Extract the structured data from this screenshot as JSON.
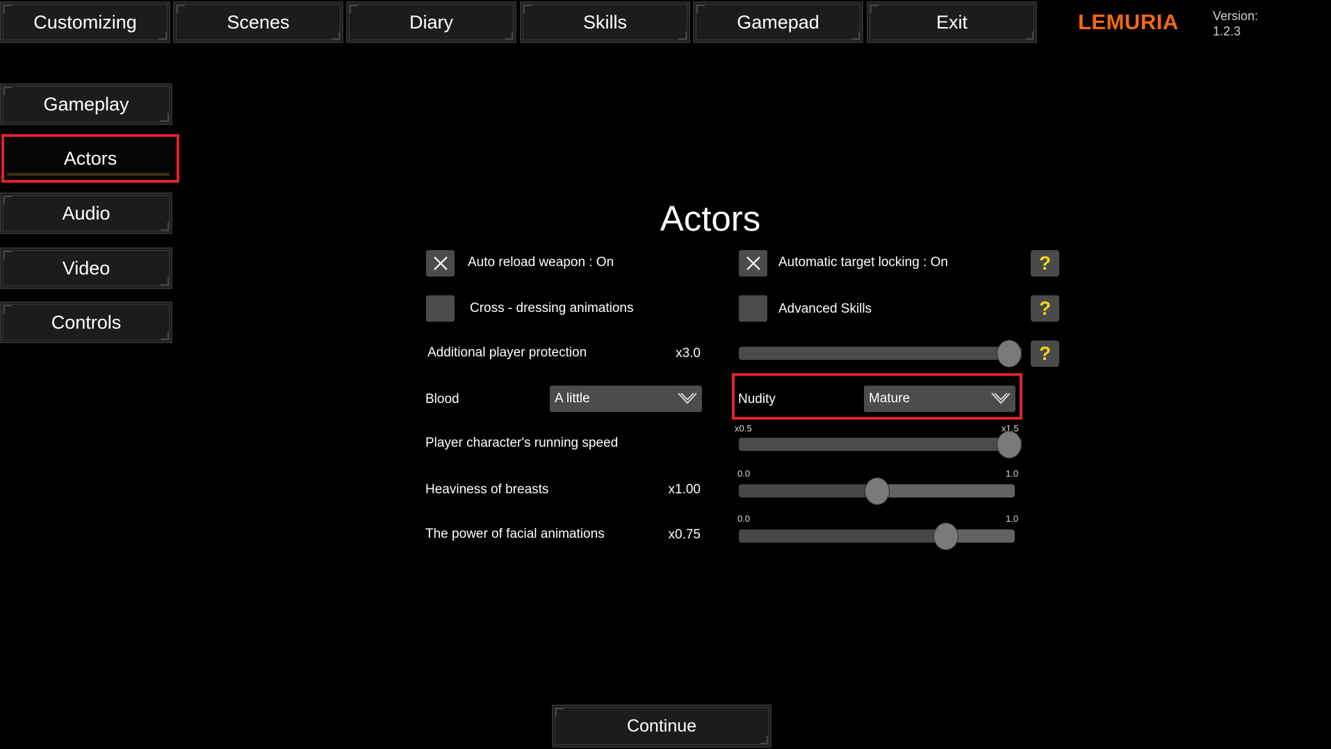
{
  "top_nav": [
    {
      "label": "Customizing"
    },
    {
      "label": "Scenes"
    },
    {
      "label": "Diary"
    },
    {
      "label": "Skills"
    },
    {
      "label": "Gamepad"
    },
    {
      "label": "Exit"
    }
  ],
  "brand": {
    "name": "LEMURIA",
    "color": "#f26a0f"
  },
  "version": {
    "label": "Version:",
    "value": "1.2.3"
  },
  "sidebar": {
    "items": [
      {
        "label": "Gameplay",
        "active": false
      },
      {
        "label": "Actors",
        "active": true
      },
      {
        "label": "Audio",
        "active": false
      },
      {
        "label": "Video",
        "active": false
      },
      {
        "label": "Controls",
        "active": false
      }
    ]
  },
  "page": {
    "title": "Actors"
  },
  "settings": {
    "auto_reload": {
      "label": "Auto reload weapon : On",
      "checked": true
    },
    "cross_dressing": {
      "label": "Cross - dressing animations",
      "checked": false
    },
    "target_locking": {
      "label": "Automatic target locking : On",
      "checked": true
    },
    "advanced_skills": {
      "label": "Advanced Skills",
      "checked": false
    },
    "player_protection": {
      "label": "Additional player protection",
      "value": "x3.0",
      "fraction": 1.0
    },
    "blood": {
      "label": "Blood",
      "selected": "A little"
    },
    "nudity": {
      "label": "Nudity",
      "selected": "Mature"
    },
    "running_speed": {
      "label": "Player character's running speed",
      "min_label": "x0.5",
      "max_label": "x1.5",
      "fraction": 1.0
    },
    "breasts": {
      "label": "Heaviness of breasts",
      "value": "x1.00",
      "min_label": "0.0",
      "max_label": "1.0",
      "fraction": 0.5
    },
    "facial": {
      "label": "The power of facial animations",
      "value": "x0.75",
      "min_label": "0.0",
      "max_label": "1.0",
      "fraction": 0.75
    }
  },
  "help_icon": "?",
  "continue_label": "Continue",
  "highlight_color": "#e0212b"
}
